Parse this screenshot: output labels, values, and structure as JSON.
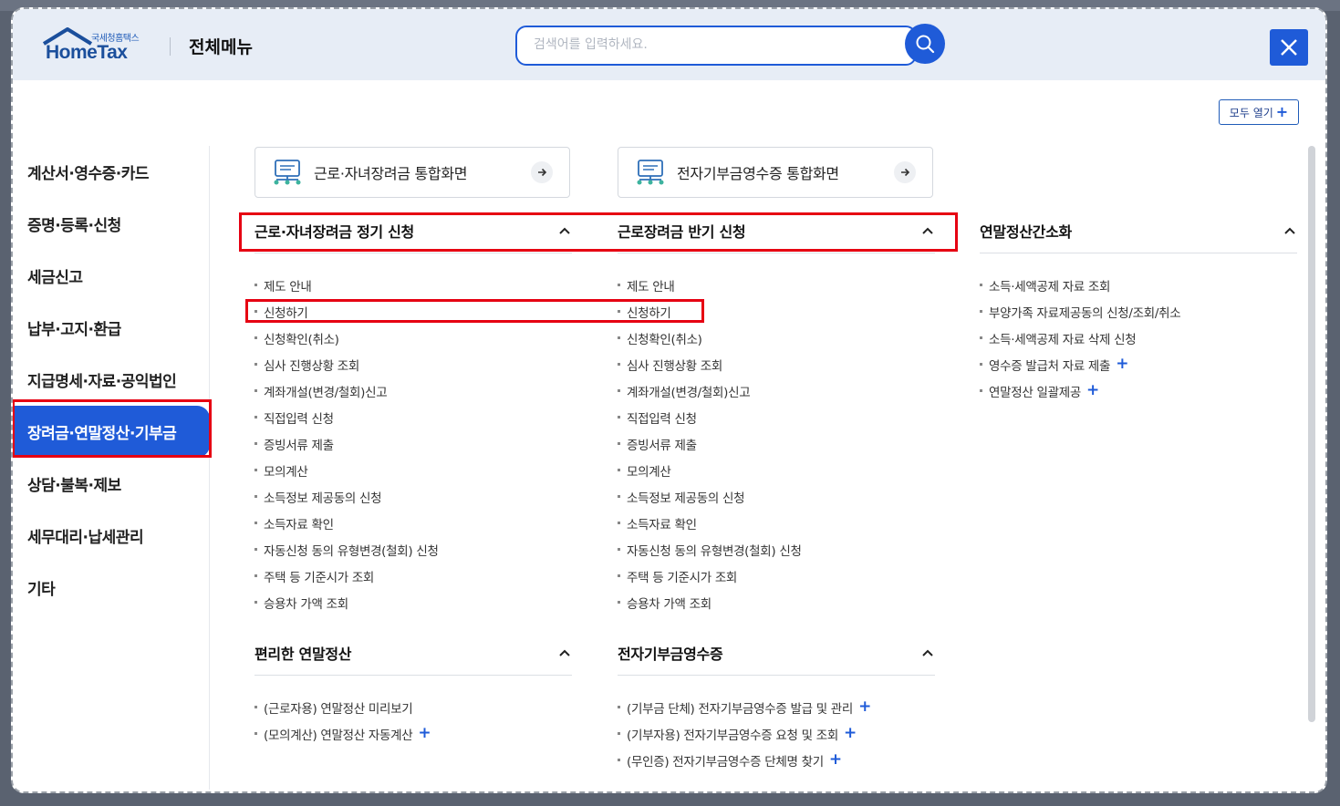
{
  "header": {
    "logo_kr": "국세청홈택스",
    "logo_en": "HomeTax",
    "title": "전체메뉴",
    "search_placeholder": "검색어를 입력하세요.",
    "open_all_label": "모두 열기"
  },
  "sidebar": {
    "items": [
      {
        "label": "계산서·영수증·카드"
      },
      {
        "label": "증명·등록·신청"
      },
      {
        "label": "세금신고"
      },
      {
        "label": "납부·고지·환급"
      },
      {
        "label": "지급명세·자료·공익법인"
      },
      {
        "label": "장려금·연말정산·기부금",
        "active": true
      },
      {
        "label": "상담·불복·제보"
      },
      {
        "label": "세무대리·납세관리"
      },
      {
        "label": "기타"
      }
    ]
  },
  "quick_buttons": [
    {
      "label": "근로·자녀장려금 통합화면"
    },
    {
      "label": "전자기부금영수증 통합화면"
    }
  ],
  "sections": {
    "regular": {
      "title": "근로·자녀장려금 정기 신청",
      "items": [
        "제도 안내",
        "신청하기",
        "신청확인(취소)",
        "심사 진행상황 조회",
        "계좌개설(변경/철회)신고",
        "직접입력 신청",
        "증빙서류 제출",
        "모의계산",
        "소득정보 제공동의 신청",
        "소득자료 확인",
        "자동신청 동의 유형변경(철회) 신청",
        "주택 등 기준시가 조회",
        "승용차 가액 조회"
      ]
    },
    "half": {
      "title": "근로장려금 반기 신청",
      "items": [
        "제도 안내",
        "신청하기",
        "신청확인(취소)",
        "심사 진행상황 조회",
        "계좌개설(변경/철회)신고",
        "직접입력 신청",
        "증빙서류 제출",
        "모의계산",
        "소득정보 제공동의 신청",
        "소득자료 확인",
        "자동신청 동의 유형변경(철회) 신청",
        "주택 등 기준시가 조회",
        "승용차 가액 조회"
      ]
    },
    "simple": {
      "title": "연말정산간소화",
      "items": [
        {
          "label": "소득·세액공제 자료 조회",
          "plus": false
        },
        {
          "label": "부양가족 자료제공동의 신청/조회/취소",
          "plus": false
        },
        {
          "label": "소득·세액공제 자료 삭제 신청",
          "plus": false
        },
        {
          "label": "영수증 발급처 자료 제출",
          "plus": true
        },
        {
          "label": "연말정산 일괄제공",
          "plus": true
        }
      ]
    },
    "convenient": {
      "title": "편리한 연말정산",
      "items": [
        {
          "label": "(근로자용) 연말정산 미리보기",
          "plus": false
        },
        {
          "label": "(모의계산) 연말정산 자동계산",
          "plus": true
        }
      ]
    },
    "donation": {
      "title": "전자기부금영수증",
      "items": [
        {
          "label": "(기부금 단체) 전자기부금영수증 발급 및 관리",
          "plus": true
        },
        {
          "label": "(기부자용) 전자기부금영수증 요청 및 조회",
          "plus": true
        },
        {
          "label": "(무인증) 전자기부금영수증 단체명 찾기",
          "plus": true
        }
      ]
    }
  },
  "colors": {
    "accent": "#1f5bd8",
    "highlight": "#e60012",
    "header_bg": "#e7edf6"
  }
}
